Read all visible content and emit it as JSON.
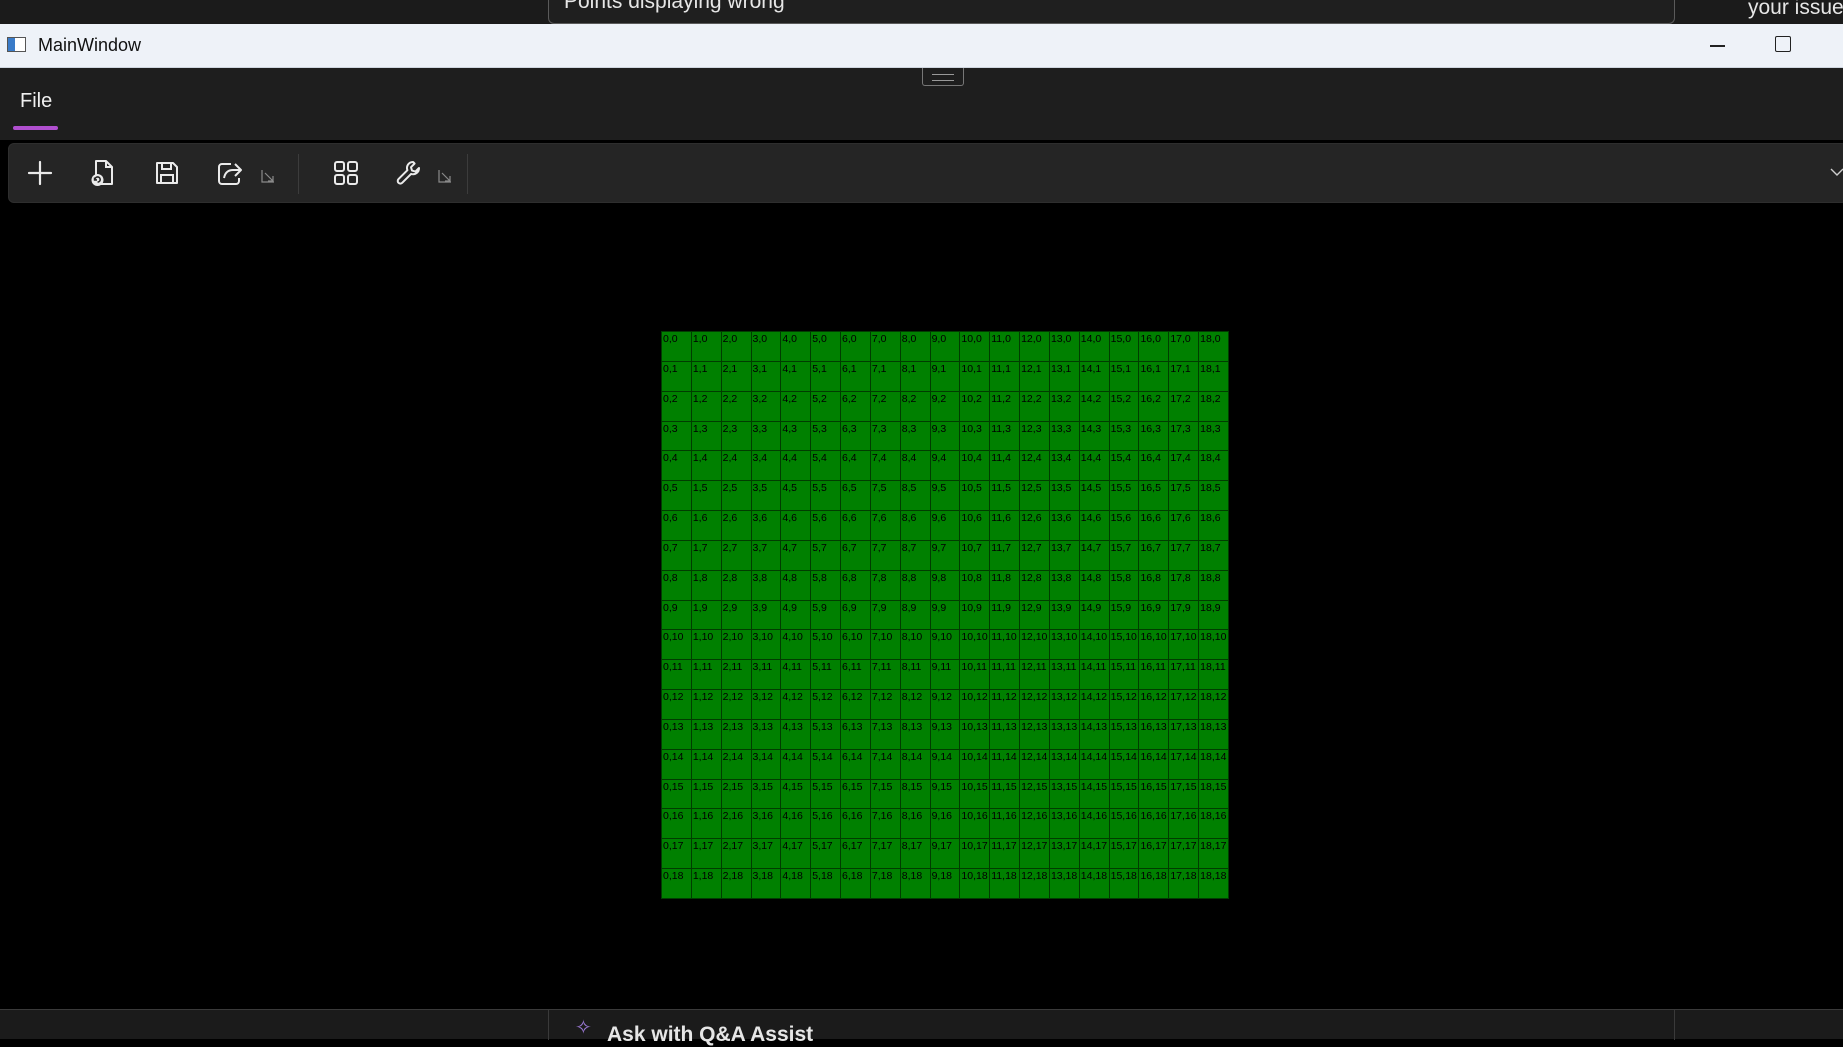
{
  "background": {
    "question_title": "Points displaying wrong",
    "right_text": "your issue",
    "qa_assist_label": "Ask with Q&A Assist"
  },
  "window": {
    "title": "MainWindow"
  },
  "menu": {
    "file_tab": "File",
    "accent_color": "#b04fcf"
  },
  "ribbon": {
    "buttons": [
      {
        "icon": "plus-icon"
      },
      {
        "icon": "open-file-icon"
      },
      {
        "icon": "save-icon"
      },
      {
        "icon": "share-icon"
      },
      {
        "icon": "grid-view-icon"
      },
      {
        "icon": "wrench-icon"
      }
    ]
  },
  "grid": {
    "columns": 19,
    "rows": 19,
    "cell_color": "#008000",
    "label_format": "x,y"
  }
}
